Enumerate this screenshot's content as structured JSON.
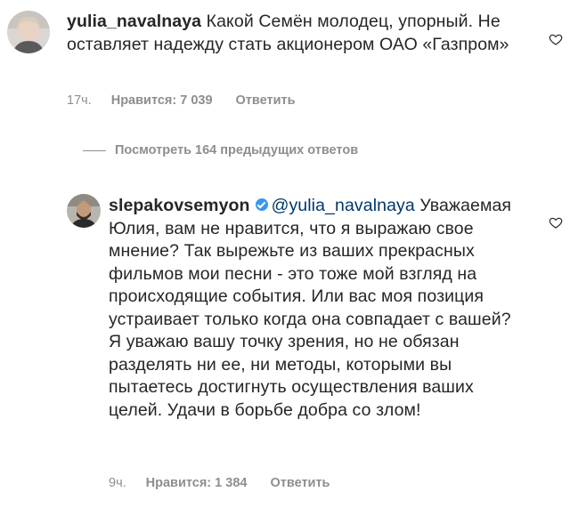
{
  "comment1": {
    "username": "yulia_navalnaya",
    "text": "Какой Семён молодец, упорный. Не оставляет надежду стать акционером ОАО «Газпром»",
    "time": "17ч.",
    "likes_label": "Нравится: 7 039",
    "reply_label": "Ответить"
  },
  "view_replies": {
    "label": "Посмотреть 164 предыдущих ответов"
  },
  "comment2": {
    "username": "slepakovsemyon",
    "mention": "@yulia_navalnaya",
    "text": "Уважаемая Юлия, вам не нравится, что я выражаю свое мнение? Так вырежьте из ваших прекрасных фильмов мои песни - это тоже мой взгляд на происходящие события. Или вас моя позиция устраивает только когда она совпадает с вашей? Я уважаю вашу точку зрения, но не обязан разделять ни ее, ни методы, которыми вы пытаетесь достигнуть осуществления ваших целей. Удачи в борьбе добра со злом!",
    "time": "9ч.",
    "likes_label": "Нравится: 1 384",
    "reply_label": "Ответить"
  },
  "icons": {
    "avatar1": "user-avatar",
    "avatar2": "user-avatar",
    "verified": "verified-badge-icon",
    "heart": "heart-outline-icon"
  },
  "colors": {
    "text": "#262626",
    "meta": "#8e8e8e",
    "mention": "#00376b",
    "verified": "#3897f0"
  }
}
